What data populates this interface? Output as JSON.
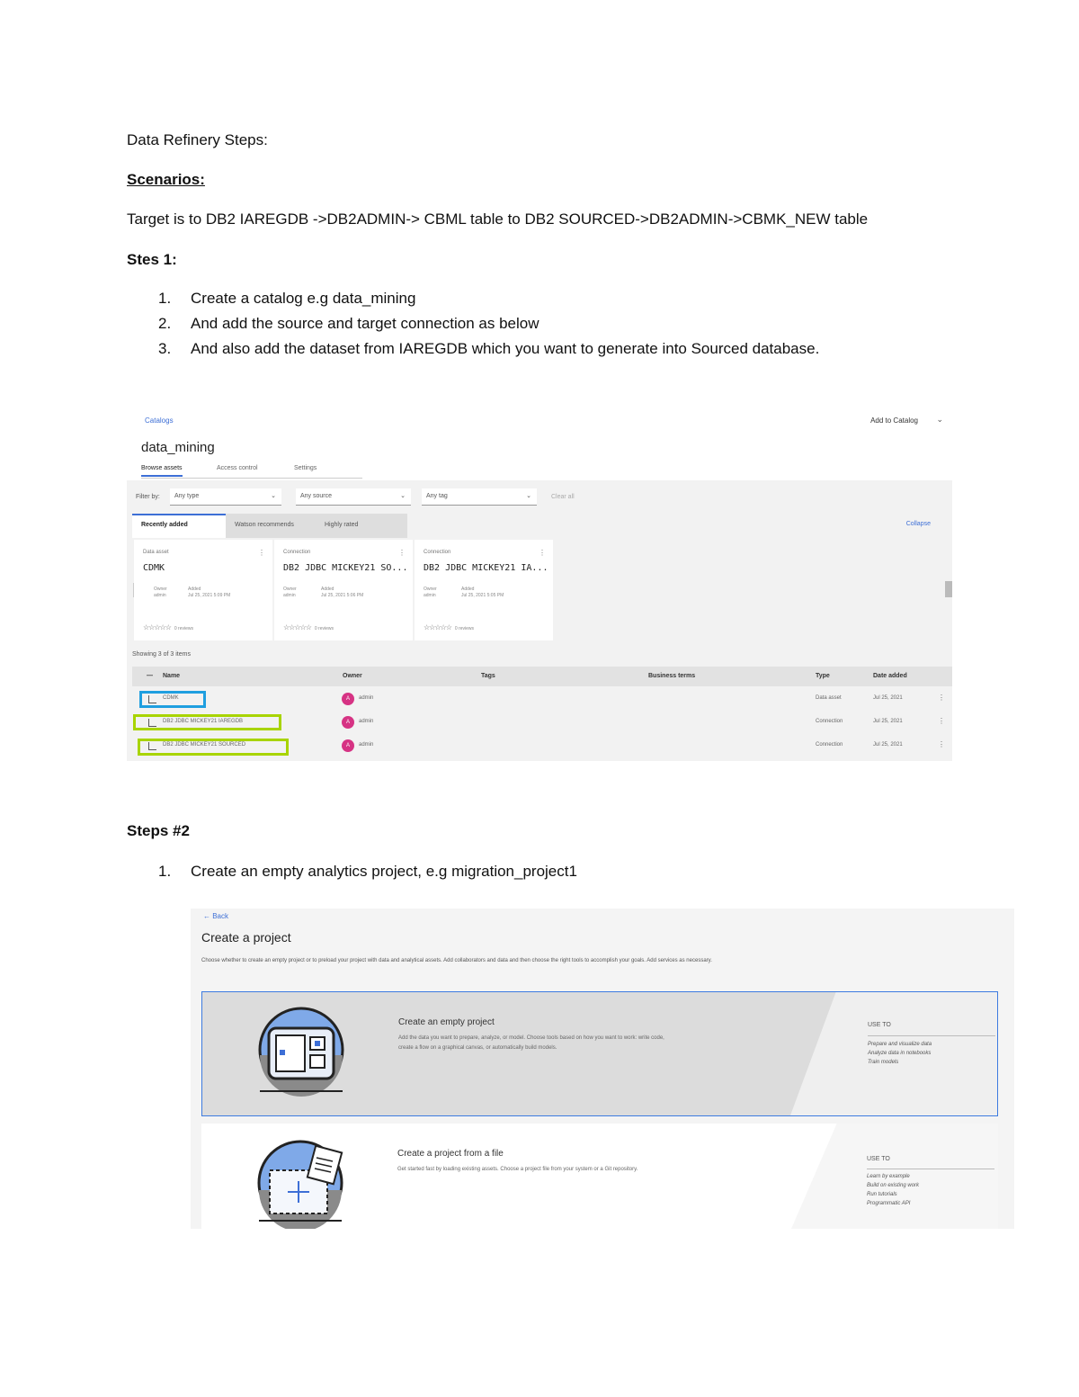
{
  "doc": {
    "title": "Data Refinery Steps:",
    "scenarios_heading": "Scenarios:",
    "target": "Target is to DB2 IAREGDB ->DB2ADMIN-> CBML table to DB2 SOURCED->DB2ADMIN->CBMK_NEW table",
    "step1_heading": "Stes 1:",
    "step1_items": [
      {
        "num": "1.",
        "text": "Create a catalog e.g data_mining"
      },
      {
        "num": "2.",
        "text": "And add the source and target connection as below"
      },
      {
        "num": "3.",
        "text": "And also add the dataset from IAREGDB which you want to generate into Sourced database."
      }
    ],
    "step2_heading": "Steps #2",
    "step2_items": [
      {
        "num": "1.",
        "text": "Create an empty analytics project, e.g migration_project1"
      }
    ]
  },
  "catalog_shot": {
    "breadcrumb": "Catalogs",
    "add_to_catalog": "Add to Catalog",
    "catalog_name": "data_mining",
    "tabs": [
      "Browse assets",
      "Access control",
      "Settings"
    ],
    "filter_label": "Filter by:",
    "filters": [
      "Any type",
      "Any source",
      "Any tag"
    ],
    "clear_all": "Clear all",
    "sub_tabs": [
      "Recently added",
      "Watson recommends",
      "Highly rated"
    ],
    "collapse": "Collapse",
    "cards": [
      {
        "kind": "Data asset",
        "name": "CDMK",
        "owner_label": "Owner",
        "owner": "admin",
        "added_label": "Added",
        "added": "Jul 25, 2021 5:09 PM",
        "reviews": "0 reviews"
      },
      {
        "kind": "Connection",
        "name": "DB2 JDBC MICKEY21 SO...",
        "owner_label": "Owner",
        "owner": "admin",
        "added_label": "Added",
        "added": "Jul 25, 2021 5:06 PM",
        "reviews": "0 reviews"
      },
      {
        "kind": "Connection",
        "name": "DB2 JDBC MICKEY21 IA...",
        "owner_label": "Owner",
        "owner": "admin",
        "added_label": "Added",
        "added": "Jul 25, 2021 5:05 PM",
        "reviews": "0 reviews"
      }
    ],
    "stars": "☆☆☆☆☆",
    "showing": "Showing 3 of 3 items",
    "columns": [
      "Name",
      "Owner",
      "Tags",
      "Business terms",
      "Type",
      "Date added"
    ],
    "rows": [
      {
        "name": "CDMK",
        "avatar": "A",
        "owner": "admin",
        "type": "Data asset",
        "date": "Jul 25, 2021"
      },
      {
        "name": "DB2 JDBC MICKEY21 IAREGDB",
        "avatar": "A",
        "owner": "admin",
        "type": "Connection",
        "date": "Jul 25, 2021"
      },
      {
        "name": "DB2 JDBC MICKEY21 SOURCED",
        "avatar": "A",
        "owner": "admin",
        "type": "Connection",
        "date": "Jul 25, 2021"
      }
    ]
  },
  "project_shot": {
    "back": "← Back",
    "title": "Create a project",
    "desc": "Choose whether to create an empty project or to preload your project with data and analytical assets. Add collaborators and data and then choose the right tools to accomplish your goals. Add services as necessary.",
    "options": [
      {
        "title": "Create an empty project",
        "desc": "Add the data you want to prepare, analyze, or model. Choose tools based on how you want to work: write code, create a flow on a graphical canvas, or automatically build models.",
        "use_to": "USE TO",
        "uses": [
          "Prepare and visualize data",
          "Analyze data in notebooks",
          "Train models"
        ]
      },
      {
        "title": "Create a project from a file",
        "desc": "Get started fast by loading existing assets. Choose a project file from your system or a Git repository.",
        "use_to": "USE TO",
        "uses": [
          "Learn by example",
          "Build on existing work",
          "Run tutorials",
          "Programmatic API"
        ]
      }
    ]
  }
}
